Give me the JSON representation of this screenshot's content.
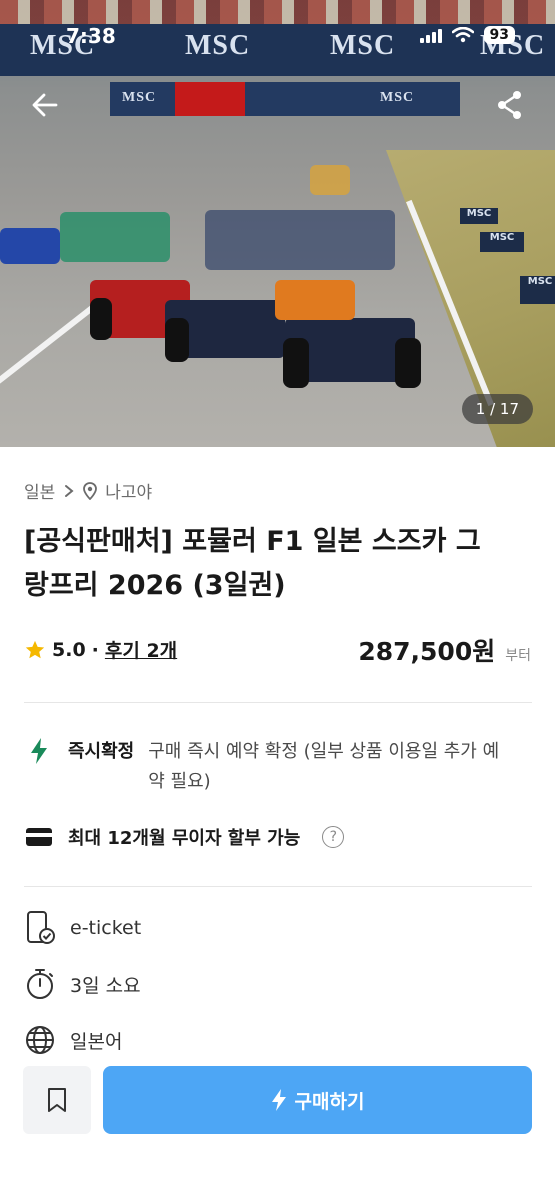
{
  "status_bar": {
    "time": "7:38",
    "battery": "93"
  },
  "hero": {
    "banner_text": "MSC",
    "counter": "1 / 17"
  },
  "breadcrumb": {
    "country": "일본",
    "city": "나고야"
  },
  "product": {
    "title_line1": "[공식판매처] 포뮬러 F1 일본 스즈카 그",
    "title_line2": "랑프리 2026 (3일권)",
    "rating": "5.0",
    "separator": "·",
    "reviews": "후기 2개",
    "price": "287,500원",
    "price_suffix": "부터"
  },
  "features": {
    "instant_label": "즉시확정",
    "instant_desc": "구매 즉시 예약 확정 (일부 상품 이용일 추가 예약 필요)",
    "installment_label": "최대 12개월 무이자 할부 가능",
    "help": "?"
  },
  "info": {
    "ticket": "e-ticket",
    "duration": "3일 소요",
    "language": "일본어"
  },
  "bottom_bar": {
    "buy_label": "구매하기"
  },
  "colors": {
    "accent": "#4da6f5",
    "instant_green": "#1a8a5a",
    "star": "#f5b800"
  }
}
